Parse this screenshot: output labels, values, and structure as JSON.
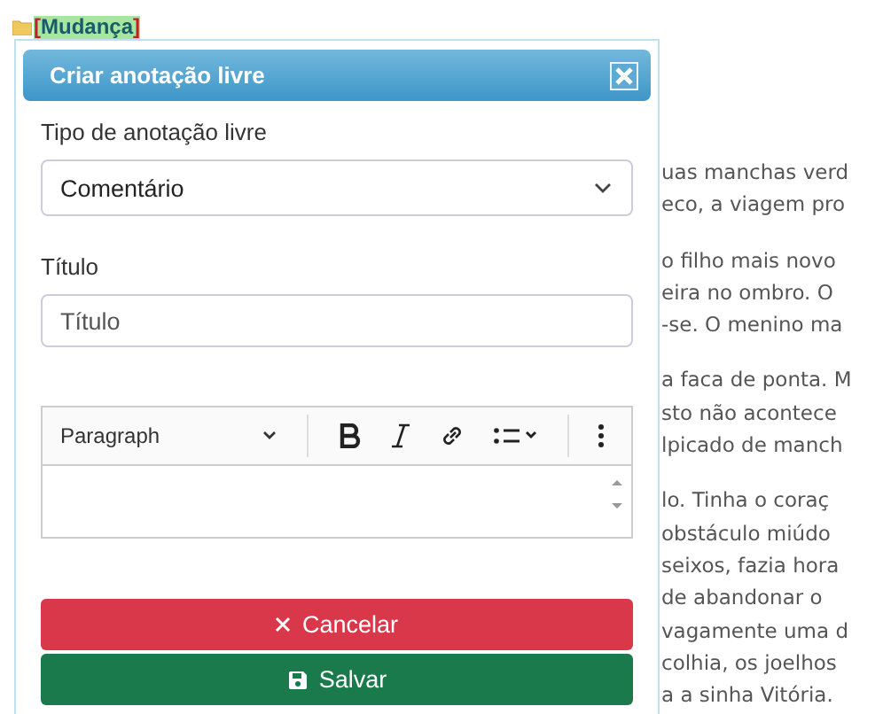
{
  "tag": "[Mudança]",
  "dialog": {
    "title": "Criar anotação livre",
    "type_field": {
      "label": "Tipo de anotação livre",
      "value": "Comentário"
    },
    "title_field": {
      "label": "Título",
      "placeholder": "Título"
    },
    "editor": {
      "block_format": "Paragraph"
    },
    "buttons": [
      {
        "kind": "cancel",
        "label": "Cancelar"
      },
      {
        "kind": "save",
        "label": "Salvar"
      }
    ]
  },
  "background_text": [
    [
      "uas manchas verd",
      "eco, a viagem pro"
    ],
    [
      "o filho mais novo",
      "eira no ombro. O",
      "-se. O menino ma"
    ],
    [
      "a faca de ponta. M",
      "sto não acontece",
      "lpicado de manch"
    ],
    [
      "lo. Tinha o coraç",
      "obstáculo miúdo",
      "seixos, fazia hora",
      "de abandonar o",
      "vagamente uma d",
      "colhia, os joelhos",
      "a a sinha Vitória."
    ]
  ]
}
